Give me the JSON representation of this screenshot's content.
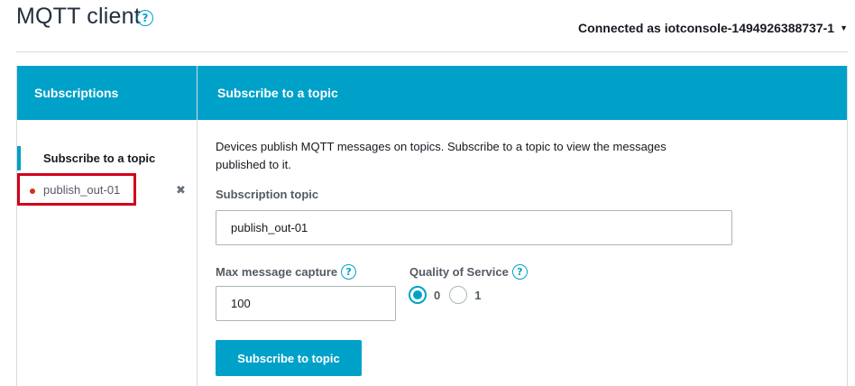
{
  "header": {
    "title": "MQTT client",
    "connected_label": "Connected as iotconsole-1494926388737-1"
  },
  "subscriptions": {
    "heading": "Subscriptions",
    "subscribe_link": "Subscribe to a topic",
    "items": [
      {
        "topic": "publish_out-01"
      }
    ]
  },
  "main": {
    "heading": "Subscribe to a topic",
    "description": "Devices publish MQTT messages on topics. Subscribe to a topic to view the messages published to it.",
    "subscription_topic_label": "Subscription topic",
    "subscription_topic_value": "publish_out-01",
    "max_capture_label": "Max message capture",
    "max_capture_value": "100",
    "qos_label": "Quality of Service",
    "qos_options": [
      "0",
      "1"
    ],
    "qos_selected": "0",
    "submit_label": "Subscribe to topic"
  },
  "colors": {
    "accent": "#00a1c9",
    "highlight_border": "#d0021b",
    "status_dot": "#d13212"
  },
  "icons": {
    "help": "question-circle-icon",
    "caret": "caret-down-icon",
    "remove": "close-icon"
  }
}
